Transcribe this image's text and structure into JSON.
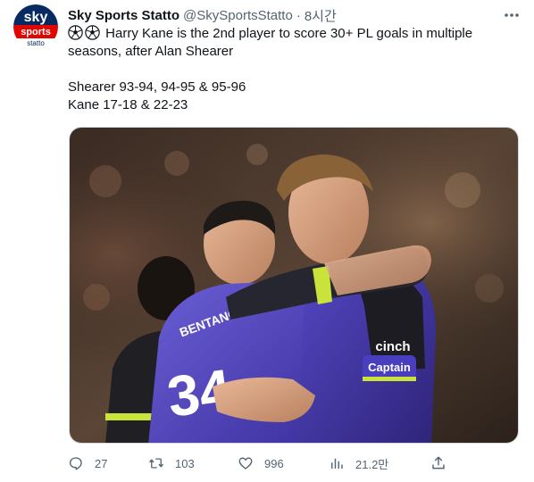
{
  "tweet": {
    "avatar_logo": {
      "sky": "sky",
      "sports": "sports",
      "statto": "statto"
    },
    "display_name": "Sky Sports Statto",
    "handle": "@SkySportsStatto",
    "separator": "·",
    "time": "8시간",
    "more_icon": "more-horizontal-icon",
    "text": {
      "line1": "Harry Kane is the 2nd player to score 30+ PL goals in multiple",
      "line2": "seasons, after Alan Shearer",
      "line3": "Shearer 93-94, 94-95 & 95-96",
      "line4": "Kane 17-18 & 22-23"
    },
    "emojis": [
      "soccer-ball-emoji",
      "soccer-ball-emoji"
    ],
    "image": {
      "description_icon": "photo",
      "jersey_number": "34",
      "armband": "Captain",
      "sponsor": "cinch"
    },
    "actions": {
      "reply": {
        "icon": "reply-icon",
        "count": "27"
      },
      "retweet": {
        "icon": "retweet-icon",
        "count": "103"
      },
      "like": {
        "icon": "heart-icon",
        "count": "996"
      },
      "views": {
        "icon": "views-icon",
        "count": "21.2만"
      },
      "share": {
        "icon": "share-icon"
      }
    },
    "colors": {
      "text_primary": "#0f1419",
      "text_secondary": "#536471",
      "brand_red": "#e10600",
      "brand_blue": "#072a60"
    }
  }
}
